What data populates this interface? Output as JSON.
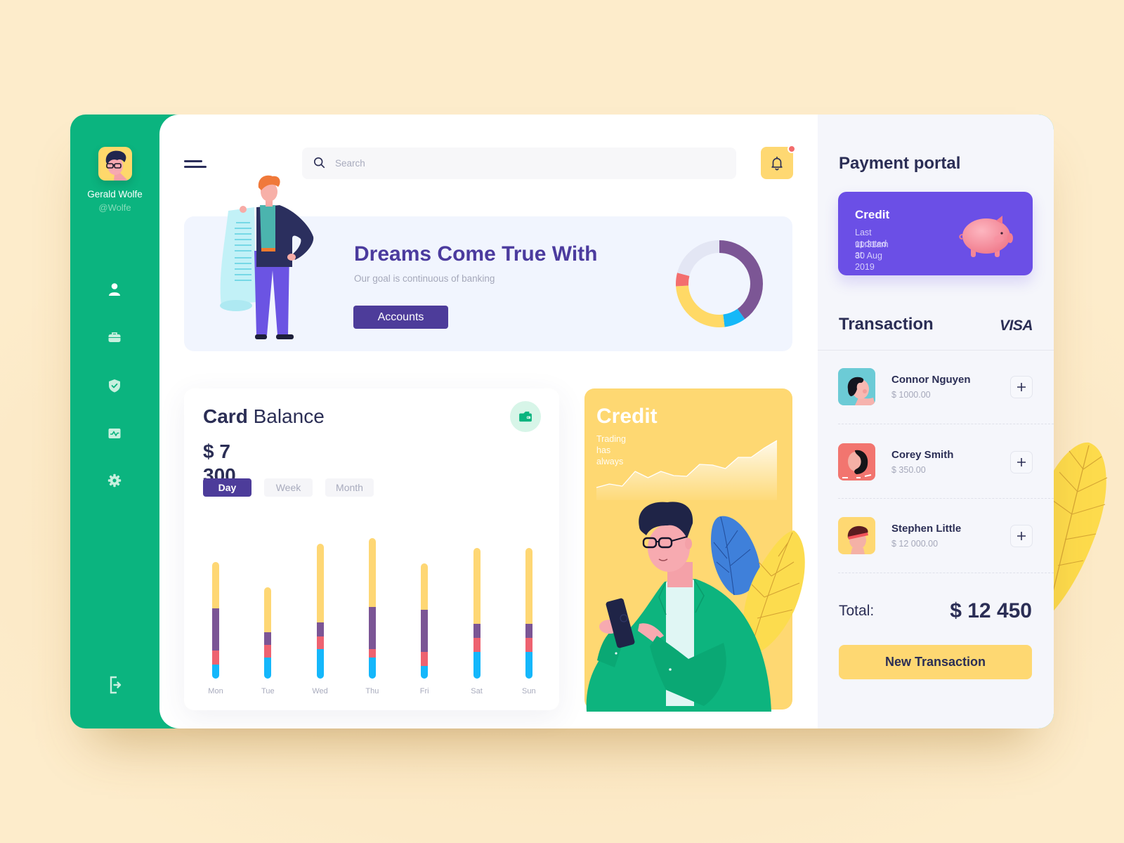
{
  "theme": {
    "background": "#fdecca",
    "sidebar_green": "#0bb47f",
    "primary_purple": "#4d3c9a",
    "accent_yellow": "#fed872",
    "text_navy": "#2b2e55",
    "notification_red": "#f36c6c"
  },
  "sidebar": {
    "user": {
      "name": "Gerald Wolfe",
      "handle": "@Wolfe",
      "avatar": "user-avatar-glasses"
    },
    "nav": [
      {
        "icon": "user-icon",
        "active": true
      },
      {
        "icon": "briefcase-icon",
        "active": false
      },
      {
        "icon": "shield-check-icon",
        "active": false
      },
      {
        "icon": "activity-icon",
        "active": false
      },
      {
        "icon": "gear-icon",
        "active": false
      }
    ],
    "logout_icon": "logout-icon"
  },
  "header": {
    "menu_icon": "hamburger-icon",
    "search_placeholder": "Search",
    "notification_icon": "bell-icon",
    "has_notification": true
  },
  "banner": {
    "title": "Dreams Come True With",
    "subtitle": "Our goal is continuous of banking",
    "button_label": "Accounts"
  },
  "card_balance": {
    "title_strong": "Card",
    "title_light": "Balance",
    "amount": "$ 7 300",
    "icon": "wallet-icon",
    "tabs": [
      {
        "label": "Day",
        "active": true
      },
      {
        "label": "Week",
        "active": false
      },
      {
        "label": "Month",
        "active": false
      }
    ]
  },
  "credit_promo": {
    "title": "Credit",
    "subtitle": "Trading has always"
  },
  "payment_portal": {
    "title": "Payment portal",
    "card": {
      "title": "Credit",
      "updated_label": "Last updated at",
      "updated_time": "11:31am 30 Aug 2019",
      "color": "#6b4fe6",
      "icon": "piggy-bank-icon"
    }
  },
  "transactions": {
    "title": "Transaction",
    "card_brand": "VISA",
    "items": [
      {
        "name": "Connor Nguyen",
        "amount": "$ 1000.00",
        "avatar_color": "#6ccbd6"
      },
      {
        "name": "Corey Smith",
        "amount": "$ 350.00",
        "avatar_color": "#f2756f"
      },
      {
        "name": "Stephen Little",
        "amount": "$ 12 000.00",
        "avatar_color": "#fed872"
      }
    ],
    "total_label": "Total:",
    "total_value": "$ 12 450",
    "new_button_label": "New Transaction"
  },
  "chart_data": [
    {
      "type": "pie",
      "donut": true,
      "title": "",
      "start": "top",
      "direction": "clockwise",
      "legend": "none",
      "series": [
        {
          "name": "purple",
          "value": 40,
          "color": "#7c5695"
        },
        {
          "name": "blue",
          "value": 8,
          "color": "#15b8f8"
        },
        {
          "name": "yellow",
          "value": 26,
          "color": "#ffd966"
        },
        {
          "name": "red",
          "value": 5,
          "color": "#f36e6e"
        },
        {
          "name": "gray",
          "value": 21,
          "color": "#e3e6f4"
        }
      ]
    },
    {
      "type": "bar",
      "stacked": true,
      "title": "",
      "xlabel": "",
      "ylabel": "",
      "grid": false,
      "legend": "none",
      "ylim": [
        0,
        100
      ],
      "categories": [
        "Mon",
        "Tue",
        "Wed",
        "Thu",
        "Fri",
        "Sat",
        "Sun"
      ],
      "series": [
        {
          "name": "blue",
          "color": "#14b7fb",
          "values": [
            10,
            15,
            21,
            15,
            9,
            19,
            19
          ]
        },
        {
          "name": "red",
          "color": "#ee6270",
          "values": [
            10,
            9,
            9,
            6,
            10,
            10,
            10
          ]
        },
        {
          "name": "purple",
          "color": "#7b5595",
          "values": [
            30,
            9,
            10,
            30,
            30,
            10,
            10
          ]
        },
        {
          "name": "yellow",
          "color": "#fed774",
          "values": [
            33,
            32,
            56,
            49,
            33,
            54,
            54
          ]
        }
      ]
    },
    {
      "type": "area",
      "title": "",
      "xlabel": "",
      "ylabel": "",
      "grid": false,
      "legend": "none",
      "ylim": [
        0,
        80
      ],
      "x": [
        1,
        2,
        3,
        4,
        5,
        6,
        7,
        8,
        9,
        10,
        11,
        12,
        13,
        14,
        15
      ],
      "values": [
        6,
        11,
        8,
        29,
        20,
        29,
        23,
        22,
        39,
        38,
        33,
        49,
        49,
        62,
        73
      ],
      "color": "#ffffff"
    }
  ]
}
